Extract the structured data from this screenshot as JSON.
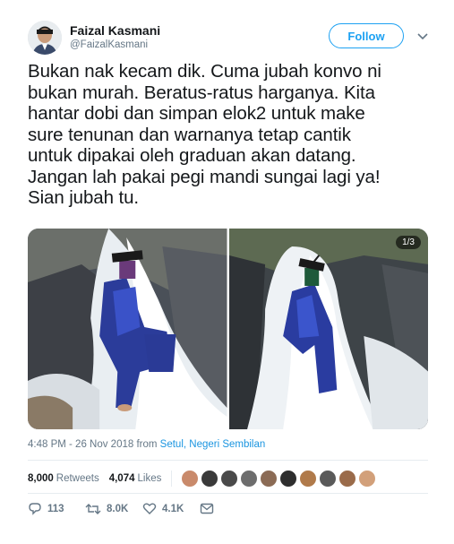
{
  "user": {
    "name": "Faizal Kasmani",
    "handle": "@FaizalKasmani"
  },
  "follow_label": "Follow",
  "tweet": {
    "text": "Bukan nak kecam dik. Cuma jubah konvo ni\nbukan murah. Beratus-ratus harganya. Kita\nhantar dobi dan simpan elok2 untuk make\nsure tenunan dan warnanya tetap cantik\nuntuk dipakai oleh graduan akan datang.\nJangan lah pakai pegi mandi sungai lagi ya!\nSian jubah tu."
  },
  "media": {
    "counter": "1/3"
  },
  "meta": {
    "time": "4:48 PM - 26 Nov 2018 from ",
    "location": "Setul, Negeri Sembilan"
  },
  "stats": {
    "retweets_count": "8,000",
    "retweets_label": "Retweets",
    "likes_count": "4,074",
    "likes_label": "Likes"
  },
  "liker_avatar_colors": [
    "#c98a6b",
    "#3a3a3a",
    "#4a4a4a",
    "#6d6d6d",
    "#8b6b55",
    "#2e2e2e",
    "#b07a4a",
    "#5a5a5a",
    "#9a6b4a",
    "#d2a07a"
  ],
  "actions": {
    "reply_count": "113",
    "retweet_count": "8.0K",
    "like_count": "4.1K"
  },
  "colors": {
    "accent": "#1da1f2",
    "link": "#1b95e0",
    "muted": "#657786",
    "text": "#14171a"
  },
  "icons": [
    "chevron-down-icon",
    "reply-icon",
    "retweet-icon",
    "like-icon",
    "message-icon"
  ]
}
